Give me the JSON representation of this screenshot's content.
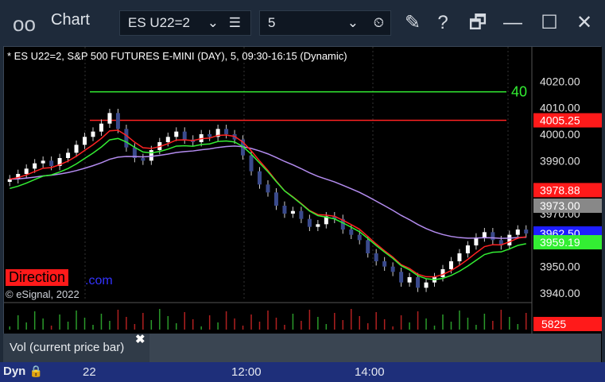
{
  "window": {
    "logo_icon": "oo",
    "title": "Chart",
    "symbol": "ES U22=2",
    "interval": "5",
    "icons": [
      "chevron-down-icon",
      "list-icon",
      "clock-icon",
      "draw-icon",
      "help-icon",
      "layout-icon",
      "maximize-icon",
      "close-icon"
    ]
  },
  "chart_header": "* ES U22=2, S&P 500 FUTURES E-MINI (DAY), 5, 09:30-16:15 (Dynamic)",
  "watermark": {
    "brand_badge": "Direction",
    "brand_suffix": ".com",
    "copyright": "© eSignal, 2022"
  },
  "colors": {
    "up": "#3a4a8c",
    "down_fill": "#ffffff",
    "price_line": "#ff2222",
    "ma_purple": "#b48cf0",
    "ma_green": "#33ee33",
    "badge_red": "#ff1a1a",
    "badge_blue": "#1e1eff"
  },
  "chart_data": {
    "type": "candlestick",
    "y_ticks": [
      "4020.00",
      "4010.00",
      "4000.00",
      "3990.00",
      "3970.00",
      "3950.00",
      "3940.00"
    ],
    "ylim": [
      3937,
      4030
    ],
    "x_ticks": [
      "22",
      "12:00",
      "14:00"
    ],
    "price_badges": [
      {
        "label": "4005.25",
        "value": 4005.25,
        "color": "#ff1a1a"
      },
      {
        "label": "3978.88",
        "value": 3978.88,
        "color": "#ff1a1a"
      },
      {
        "label": "3973.00",
        "value": 3973.0,
        "color": "#888888"
      },
      {
        "label": "3962.50",
        "value": 3962.5,
        "color": "#1e1eff"
      },
      {
        "label": "3959.19",
        "value": 3959.19,
        "color": "#33ee33"
      }
    ],
    "horizontal_lines": [
      {
        "value": 4016,
        "color": "#33ee33",
        "label": "40"
      },
      {
        "value": 4005.25,
        "color": "#ff2222"
      }
    ],
    "volume_label": "Vol (current price bar)",
    "volume_badge": "5825",
    "closes": [
      3983,
      3985,
      3987,
      3989,
      3990,
      3988,
      3991,
      3993,
      3996,
      3999,
      4001,
      4004,
      4008,
      4002,
      3995,
      3991,
      3990,
      3994,
      3997,
      3999,
      4001,
      3998,
      3997,
      4000,
      3999,
      4002,
      4000,
      3998,
      3992,
      3986,
      3981,
      3978,
      3973,
      3970,
      3971,
      3968,
      3965,
      3966,
      3969,
      3968,
      3964,
      3962,
      3960,
      3955,
      3952,
      3950,
      3948,
      3944,
      3946,
      3942,
      3944,
      3946,
      3949,
      3952,
      3955,
      3958,
      3961,
      3963,
      3960,
      3958,
      3962,
      3964,
      3962.5
    ]
  },
  "footer": {
    "dyn_label": "Dyn",
    "lock_icon": "lock-icon"
  }
}
